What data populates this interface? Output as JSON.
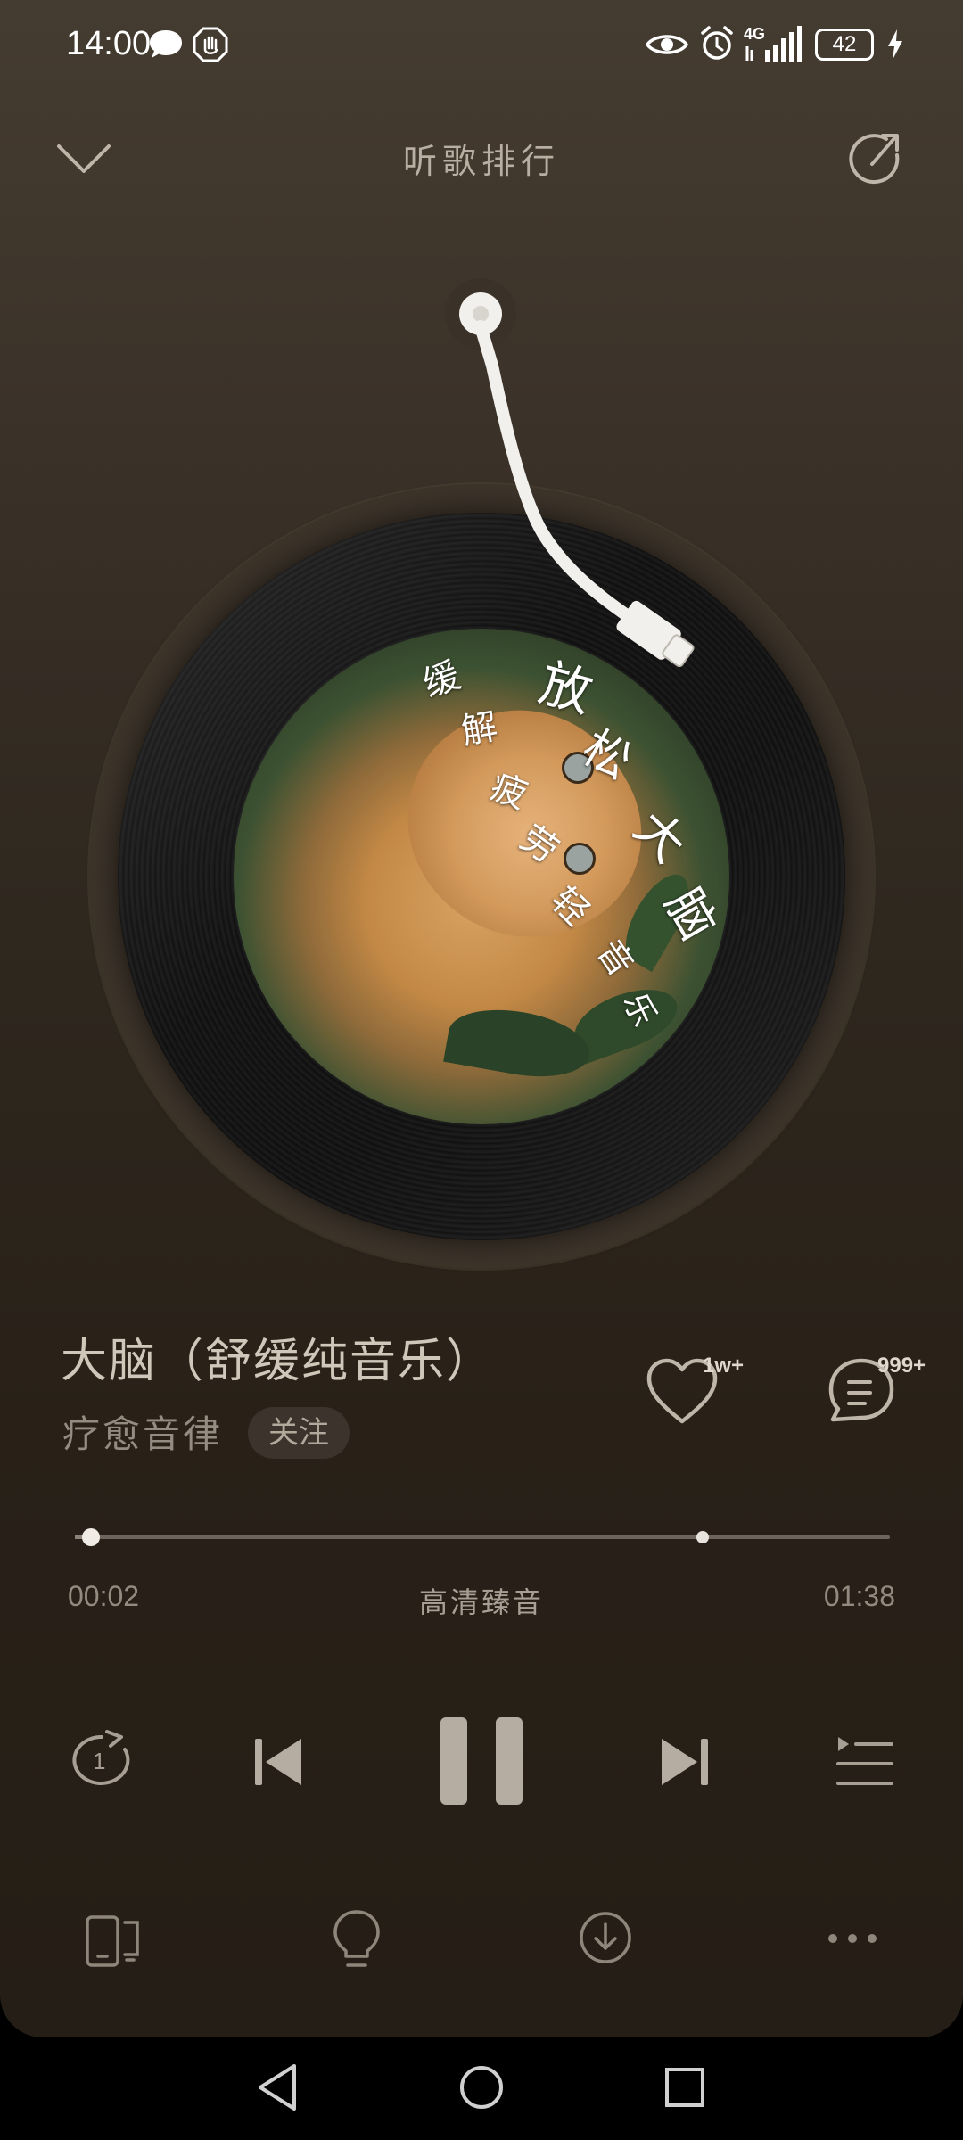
{
  "status_bar": {
    "time": "14:00",
    "network": "4G",
    "battery": "42"
  },
  "header": {
    "title": "听歌排行"
  },
  "cover_art": {
    "text": [
      "放",
      "松",
      "大",
      "脑",
      "缓",
      "解",
      "疲",
      "劳",
      "轻",
      "音",
      "乐"
    ]
  },
  "song": {
    "title": "大脑（舒缓纯音乐）",
    "artist": "疗愈音律",
    "follow_label": "关注",
    "likes": "1w+",
    "comments": "999+"
  },
  "playback": {
    "elapsed": "00:02",
    "duration": "01:38",
    "quality": "高清臻音",
    "progress": 0.02,
    "buffered": 0.77,
    "repeat_mode": "1"
  },
  "colors": {
    "background": "#3a3128",
    "accent": "#bdb3a8"
  }
}
